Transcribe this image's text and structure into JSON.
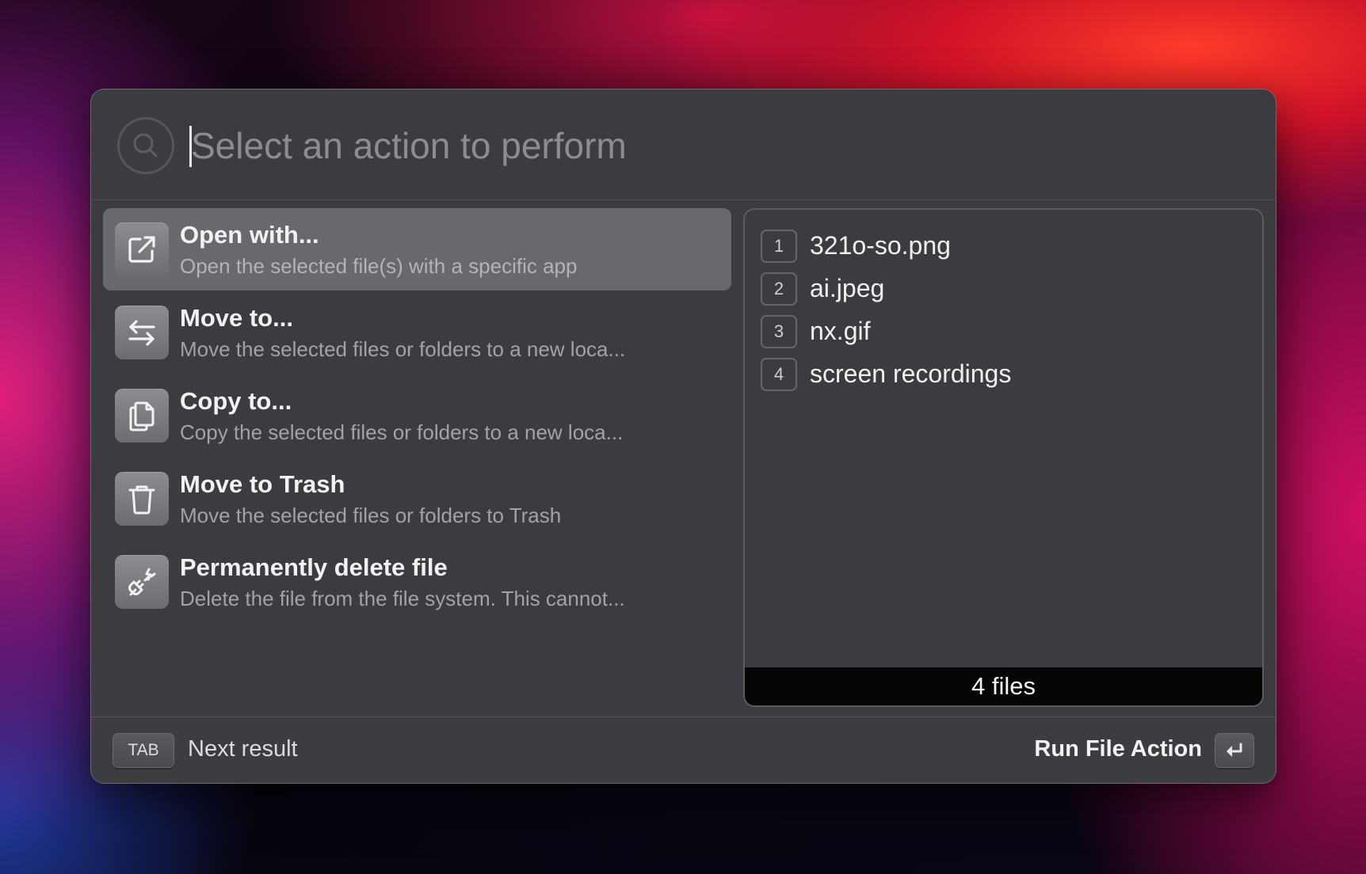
{
  "search": {
    "placeholder": "Select an action to perform",
    "value": ""
  },
  "actions": [
    {
      "title": "Open with...",
      "subtitle": "Open the selected file(s) with a specific app",
      "icon": "open-external-icon",
      "selected": true
    },
    {
      "title": "Move to...",
      "subtitle": "Move the selected files or folders to a new loca...",
      "icon": "move-arrows-icon",
      "selected": false
    },
    {
      "title": "Copy to...",
      "subtitle": "Copy the selected files or folders to a new loca...",
      "icon": "copy-documents-icon",
      "selected": false
    },
    {
      "title": "Move to Trash",
      "subtitle": "Move the selected files or folders to Trash",
      "icon": "trash-icon",
      "selected": false
    },
    {
      "title": "Permanently delete file",
      "subtitle": "Delete the file from the file system. This cannot...",
      "icon": "unplug-icon",
      "selected": false
    }
  ],
  "files": {
    "items": [
      {
        "num": "1",
        "name": "321o-so.png"
      },
      {
        "num": "2",
        "name": "ai.jpeg"
      },
      {
        "num": "3",
        "name": "nx.gif"
      },
      {
        "num": "4",
        "name": "screen recordings"
      }
    ],
    "count_label": "4 files"
  },
  "footer": {
    "tab_key": "TAB",
    "next_label": "Next result",
    "run_label": "Run File Action",
    "enter_icon": "return-key-icon"
  },
  "colors": {
    "window_bg": "#3c3b3f",
    "selected_bg": "#69686c",
    "files_footer_bg": "#050505"
  }
}
